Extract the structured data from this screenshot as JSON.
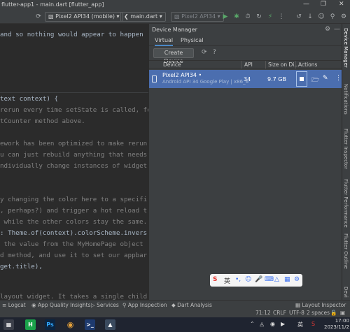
{
  "window": {
    "title": "flutter-app1 - main.dart [flutter_app]"
  },
  "toolbar": {
    "device_selector": "Pixel2 API34 (mobile)",
    "run_config": "main.dart",
    "avd_selector": "Pixel2 API34"
  },
  "editor": {
    "lines": [
      "and so nothing would appear to happen",
      "",
      "text context) {",
      "rerun every time setState is called, fo",
      "tCounter method above.",
      "",
      "ework has been optimized to make rerun",
      "u can just rebuild anything that needs",
      "ndividually change instances of widget",
      "",
      "",
      "y changing the color here to a specifi",
      ", perhaps?) and trigger a hot reload t",
      " while the other colors stay the same.",
      ": Theme.of(context).colorScheme.invers",
      " the value from the MyHomePage object",
      "d method, and use it to set our appbar",
      "get.title),",
      "",
      "",
      "layout widget. It takes a single child"
    ]
  },
  "device_manager": {
    "title": "Device Manager",
    "tabs": [
      "Virtual",
      "Physical"
    ],
    "create_button": "Create Device",
    "columns": {
      "device": "Device",
      "api": "API",
      "size": "Size on Di...",
      "actions": "Actions"
    },
    "devices": [
      {
        "name": "Pixel2 API34",
        "subtitle": "Android API 34 Google Play | x86_6",
        "api": "34",
        "size": "9.7 GB"
      }
    ]
  },
  "right_stripe": [
    "Device Manager",
    "Notifications",
    "Flutter Inspector",
    "Flutter Performance",
    "Flutter Outline",
    "Devi"
  ],
  "bottom_tools": [
    "Logcat",
    "App Quality Insights",
    "Services",
    "App Inspection",
    "Dart Analysis",
    "Layout Inspector"
  ],
  "status": {
    "position": "71:12",
    "line_sep": "CRLF",
    "encoding": "UTF-8",
    "indent": "2 spaces"
  },
  "ime": {
    "label": "英"
  },
  "taskbar": {
    "lang": "英",
    "time": "17:00",
    "date": "2023/11/2"
  }
}
